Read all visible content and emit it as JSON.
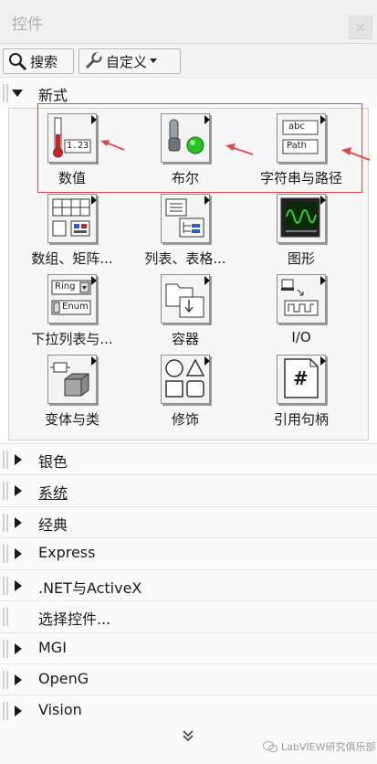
{
  "window": {
    "title": "控件"
  },
  "toolbar": {
    "search_label": "搜索",
    "custom_label": "自定义"
  },
  "expanded_category": {
    "label": "新式"
  },
  "items": [
    {
      "label": "数值",
      "icon": "numeric-icon"
    },
    {
      "label": "布尔",
      "icon": "boolean-icon"
    },
    {
      "label": "字符串与路径",
      "icon": "string-path-icon"
    },
    {
      "label": "数组、矩阵...",
      "icon": "array-matrix-icon"
    },
    {
      "label": "列表、表格...",
      "icon": "list-table-icon"
    },
    {
      "label": "图形",
      "icon": "graph-icon"
    },
    {
      "label": "下拉列表与...",
      "icon": "ring-enum-icon"
    },
    {
      "label": "容器",
      "icon": "containers-icon"
    },
    {
      "label": "I/O",
      "icon": "io-icon"
    },
    {
      "label": "变体与类",
      "icon": "variant-class-icon"
    },
    {
      "label": "修饰",
      "icon": "decorations-icon"
    },
    {
      "label": "引用句柄",
      "icon": "refnum-icon"
    }
  ],
  "icon_text": {
    "numeric": "1.23",
    "string": "abc",
    "path": "Path",
    "ring": "Ring",
    "enum": "Enum",
    "refnum": "#"
  },
  "categories": [
    {
      "label": "银色"
    },
    {
      "label": "系统"
    },
    {
      "label": "经典"
    },
    {
      "label": "Express"
    },
    {
      "label": ".NET与ActiveX"
    },
    {
      "label": "选择控件..."
    },
    {
      "label": "MGI"
    },
    {
      "label": "OpenG"
    },
    {
      "label": "Vision"
    }
  ],
  "watermark": "LabVIEW研究俱乐部",
  "colors": {
    "annotation": "#e04848",
    "led_green": "#22c422",
    "numeric_red": "#d42020"
  }
}
